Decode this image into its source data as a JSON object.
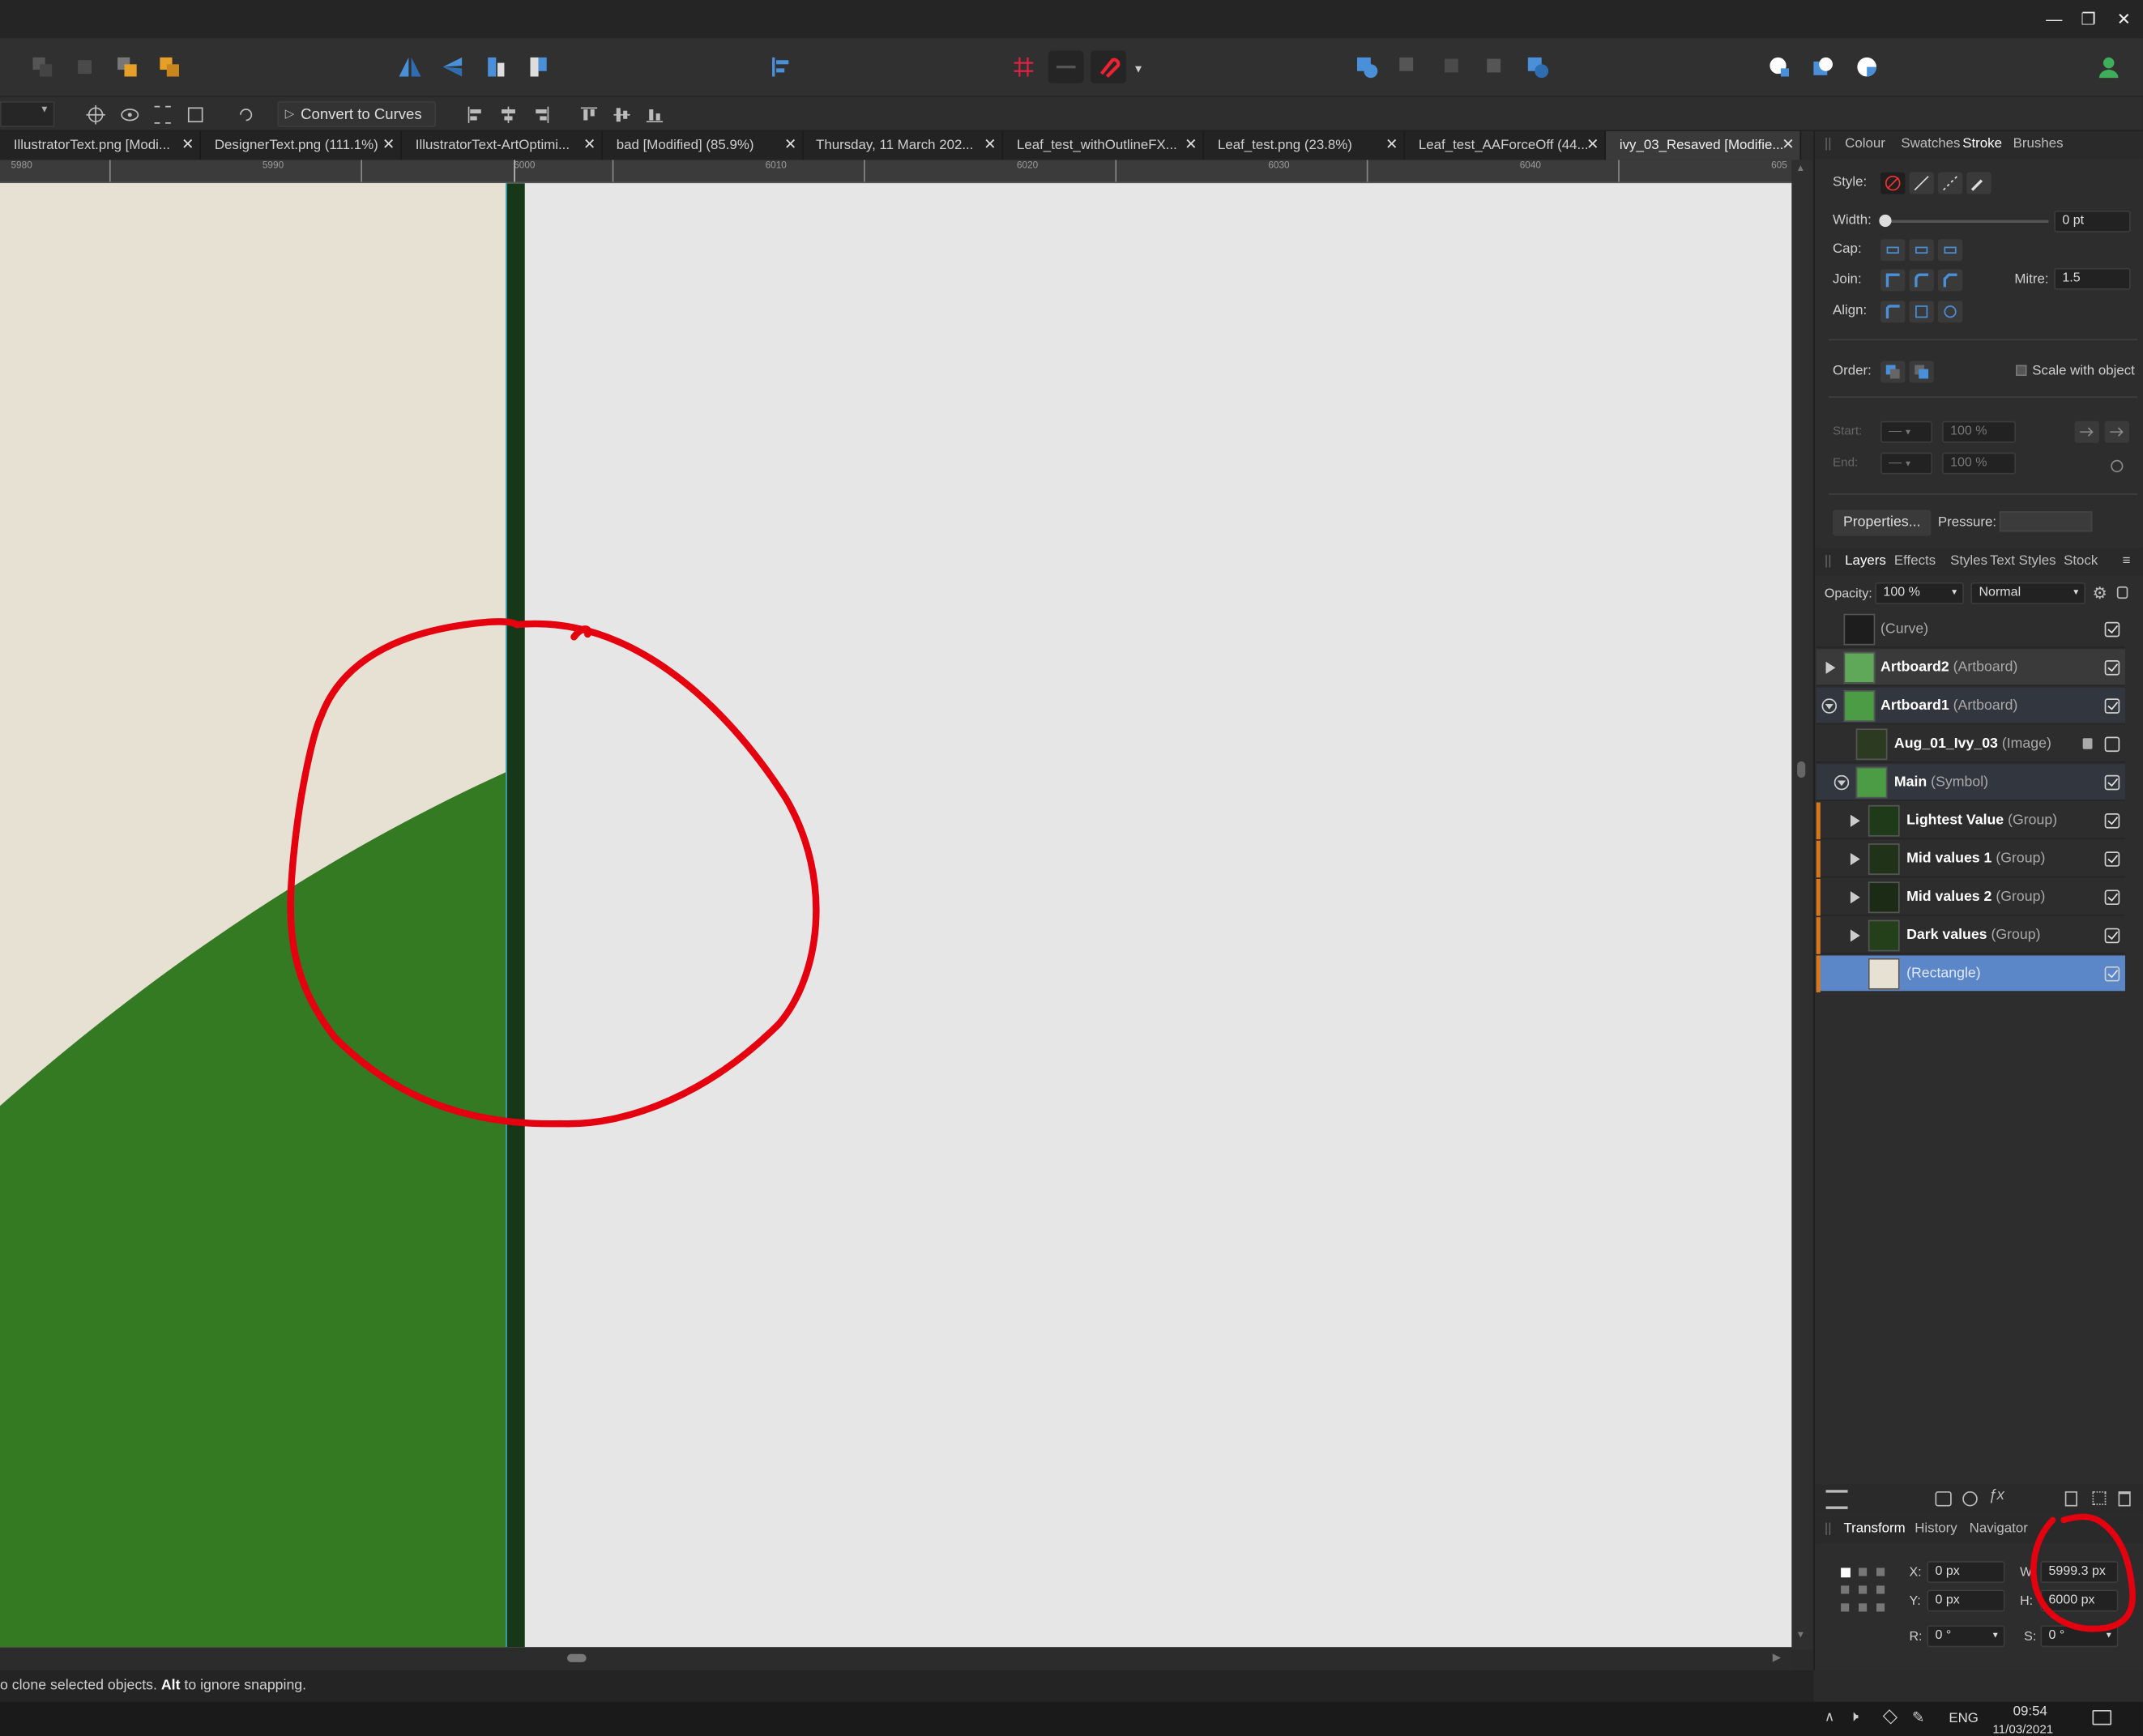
{
  "tabs": [
    {
      "label": "IllustratorText.png [Modi..."
    },
    {
      "label": "DesignerText.png (111.1%)"
    },
    {
      "label": "IllustratorText-ArtOptimi..."
    },
    {
      "label": "bad [Modified] (85.9%)"
    },
    {
      "label": "Thursday, 11 March 202..."
    },
    {
      "label": "Leaf_test_withOutlineFX..."
    },
    {
      "label": "Leaf_test.png (23.8%)"
    },
    {
      "label": "Leaf_test_AAForceOff (44..."
    },
    {
      "label": "ivy_03_Resaved [Modifie..."
    }
  ],
  "context_toolbar": {
    "convert_label": "Convert to Curves"
  },
  "ruler": {
    "labels": [
      "5980",
      "5990",
      "6000",
      "6010",
      "6020",
      "6030",
      "6040",
      "605"
    ]
  },
  "stroke_panel": {
    "tabs": [
      "Colour",
      "Swatches",
      "Stroke",
      "Brushes"
    ],
    "style_label": "Style:",
    "width_label": "Width:",
    "width_value": "0 pt",
    "cap_label": "Cap:",
    "join_label": "Join:",
    "mitre_label": "Mitre:",
    "mitre_value": "1.5",
    "align_label": "Align:",
    "order_label": "Order:",
    "scale_label": "Scale with object",
    "start_label": "Start:",
    "end_label": "End:",
    "start_pct": "100 %",
    "end_pct": "100 %",
    "properties_label": "Properties...",
    "pressure_label": "Pressure:"
  },
  "layers_panel": {
    "tabs": [
      "Layers",
      "Effects",
      "Styles",
      "Text Styles",
      "Stock"
    ],
    "opacity_label": "Opacity:",
    "opacity_value": "100 %",
    "blend_mode": "Normal",
    "layers": [
      {
        "name": "",
        "type": "(Curve)",
        "visible": true
      },
      {
        "name": "Artboard2",
        "type": "(Artboard)",
        "visible": true
      },
      {
        "name": "Artboard1",
        "type": "(Artboard)",
        "visible": true
      },
      {
        "name": "Aug_01_Ivy_03",
        "type": "(Image)",
        "visible": false,
        "locked": true
      },
      {
        "name": "Main",
        "type": "(Symbol)",
        "visible": true
      },
      {
        "name": "Lightest Value",
        "type": "(Group)",
        "visible": true
      },
      {
        "name": "Mid values 1",
        "type": "(Group)",
        "visible": true
      },
      {
        "name": "Mid values 2",
        "type": "(Group)",
        "visible": true
      },
      {
        "name": "Dark values",
        "type": "(Group)",
        "visible": true
      },
      {
        "name": "",
        "type": "(Rectangle)",
        "visible": true,
        "selected": true
      }
    ]
  },
  "transform_panel": {
    "tabs": [
      "Transform",
      "History",
      "Navigator"
    ],
    "x_label": "X:",
    "x_value": "0 px",
    "y_label": "Y:",
    "y_value": "0 px",
    "w_label": "W:",
    "w_value": "5999.3 px",
    "h_label": "H:",
    "h_value": "6000 px",
    "r_label": "R:",
    "r_value": "0 °",
    "s_label": "S:",
    "s_value": "0 °"
  },
  "status": {
    "text_pre": "o clone selected objects. ",
    "alt_key": "Alt",
    "text_post": " to ignore snapping."
  },
  "taskbar": {
    "lang": "ENG",
    "time": "09:54",
    "date": "11/03/2021"
  },
  "colors": {
    "artboard_cream": "#e7e1d4",
    "leaf_green": "#347a22",
    "dark_edge": "#163819",
    "annotation_red": "#e4000f",
    "selection_blue": "#5b87c9",
    "orange_marker": "#d7771e"
  }
}
